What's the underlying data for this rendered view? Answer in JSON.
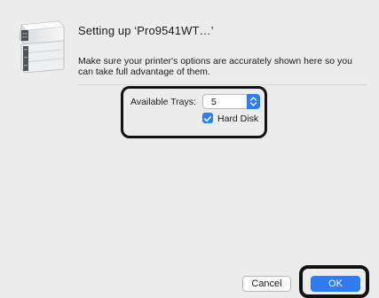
{
  "dialog": {
    "title": "Setting up ‘Pro9541WT…’",
    "description": "Make sure your printer's options are accurately shown here so you can take full advantage of them.",
    "printer_icon": "printer-icon"
  },
  "options": {
    "trays_label": "Available Trays:",
    "trays_value": "5",
    "hard_disk_label": "Hard Disk",
    "hard_disk_checked": true
  },
  "buttons": {
    "cancel_label": "Cancel",
    "ok_label": "OK"
  },
  "colors": {
    "accent": "#2d7cf1",
    "background": "#ececec",
    "highlight_frame": "#121212"
  }
}
